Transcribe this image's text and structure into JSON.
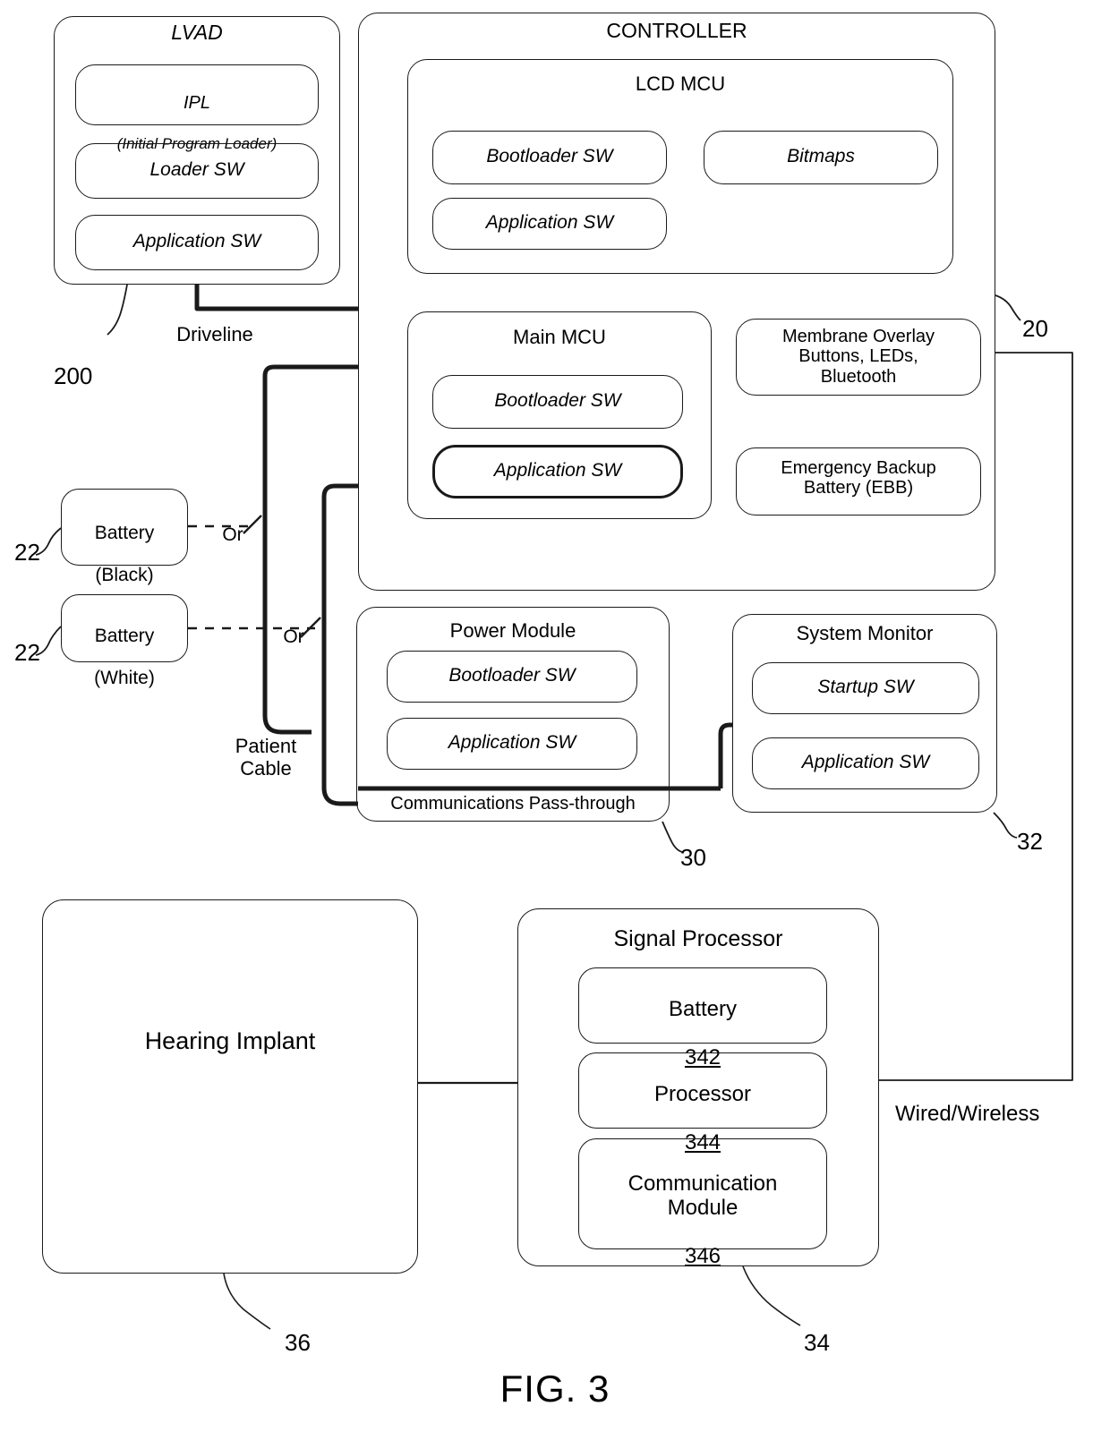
{
  "figure": {
    "caption": "FIG. 3"
  },
  "lvad": {
    "title": "LVAD",
    "ref": "200",
    "items": [
      {
        "line1": "IPL",
        "line2": "(Initial Program Loader)"
      },
      {
        "line1": "Loader SW",
        "line2": ""
      },
      {
        "line1": "Application SW",
        "line2": ""
      }
    ]
  },
  "controller": {
    "title": "CONTROLLER",
    "ref": "20",
    "lcd_mcu": {
      "title": "LCD MCU",
      "bootloader": "Bootloader SW",
      "application": "Application SW",
      "bitmaps": "Bitmaps"
    },
    "main_mcu": {
      "title": "Main MCU",
      "bootloader": "Bootloader SW",
      "application": "Application SW"
    },
    "membrane_overlay": "Membrane Overlay\nButtons, LEDs,\nBluetooth",
    "emergency_backup": "Emergency Backup\nBattery (EBB)"
  },
  "power_module": {
    "title": "Power Module",
    "ref": "30",
    "bootloader": "Bootloader SW",
    "application": "Application SW",
    "pass_through": "Communications Pass-through"
  },
  "system_monitor": {
    "title": "System Monitor",
    "ref": "32",
    "startup": "Startup SW",
    "application": "Application SW"
  },
  "batteries": [
    {
      "line1": "Battery",
      "line2": "(Black)",
      "ref": "22",
      "or_label": "Or"
    },
    {
      "line1": "Battery",
      "line2": "(White)",
      "ref": "22",
      "or_label": "Or"
    }
  ],
  "connections": {
    "driveline": "Driveline",
    "patient_cable": "Patient\nCable",
    "wired_wireless": "Wired/Wireless"
  },
  "hearing_implant": {
    "title": "Hearing Implant",
    "ref": "36"
  },
  "signal_processor": {
    "title": "Signal Processor",
    "ref": "34",
    "items": [
      {
        "name": "Battery",
        "num": "342"
      },
      {
        "name": "Processor",
        "num": "344"
      },
      {
        "name": "Communication\nModule",
        "num": "346"
      }
    ]
  }
}
